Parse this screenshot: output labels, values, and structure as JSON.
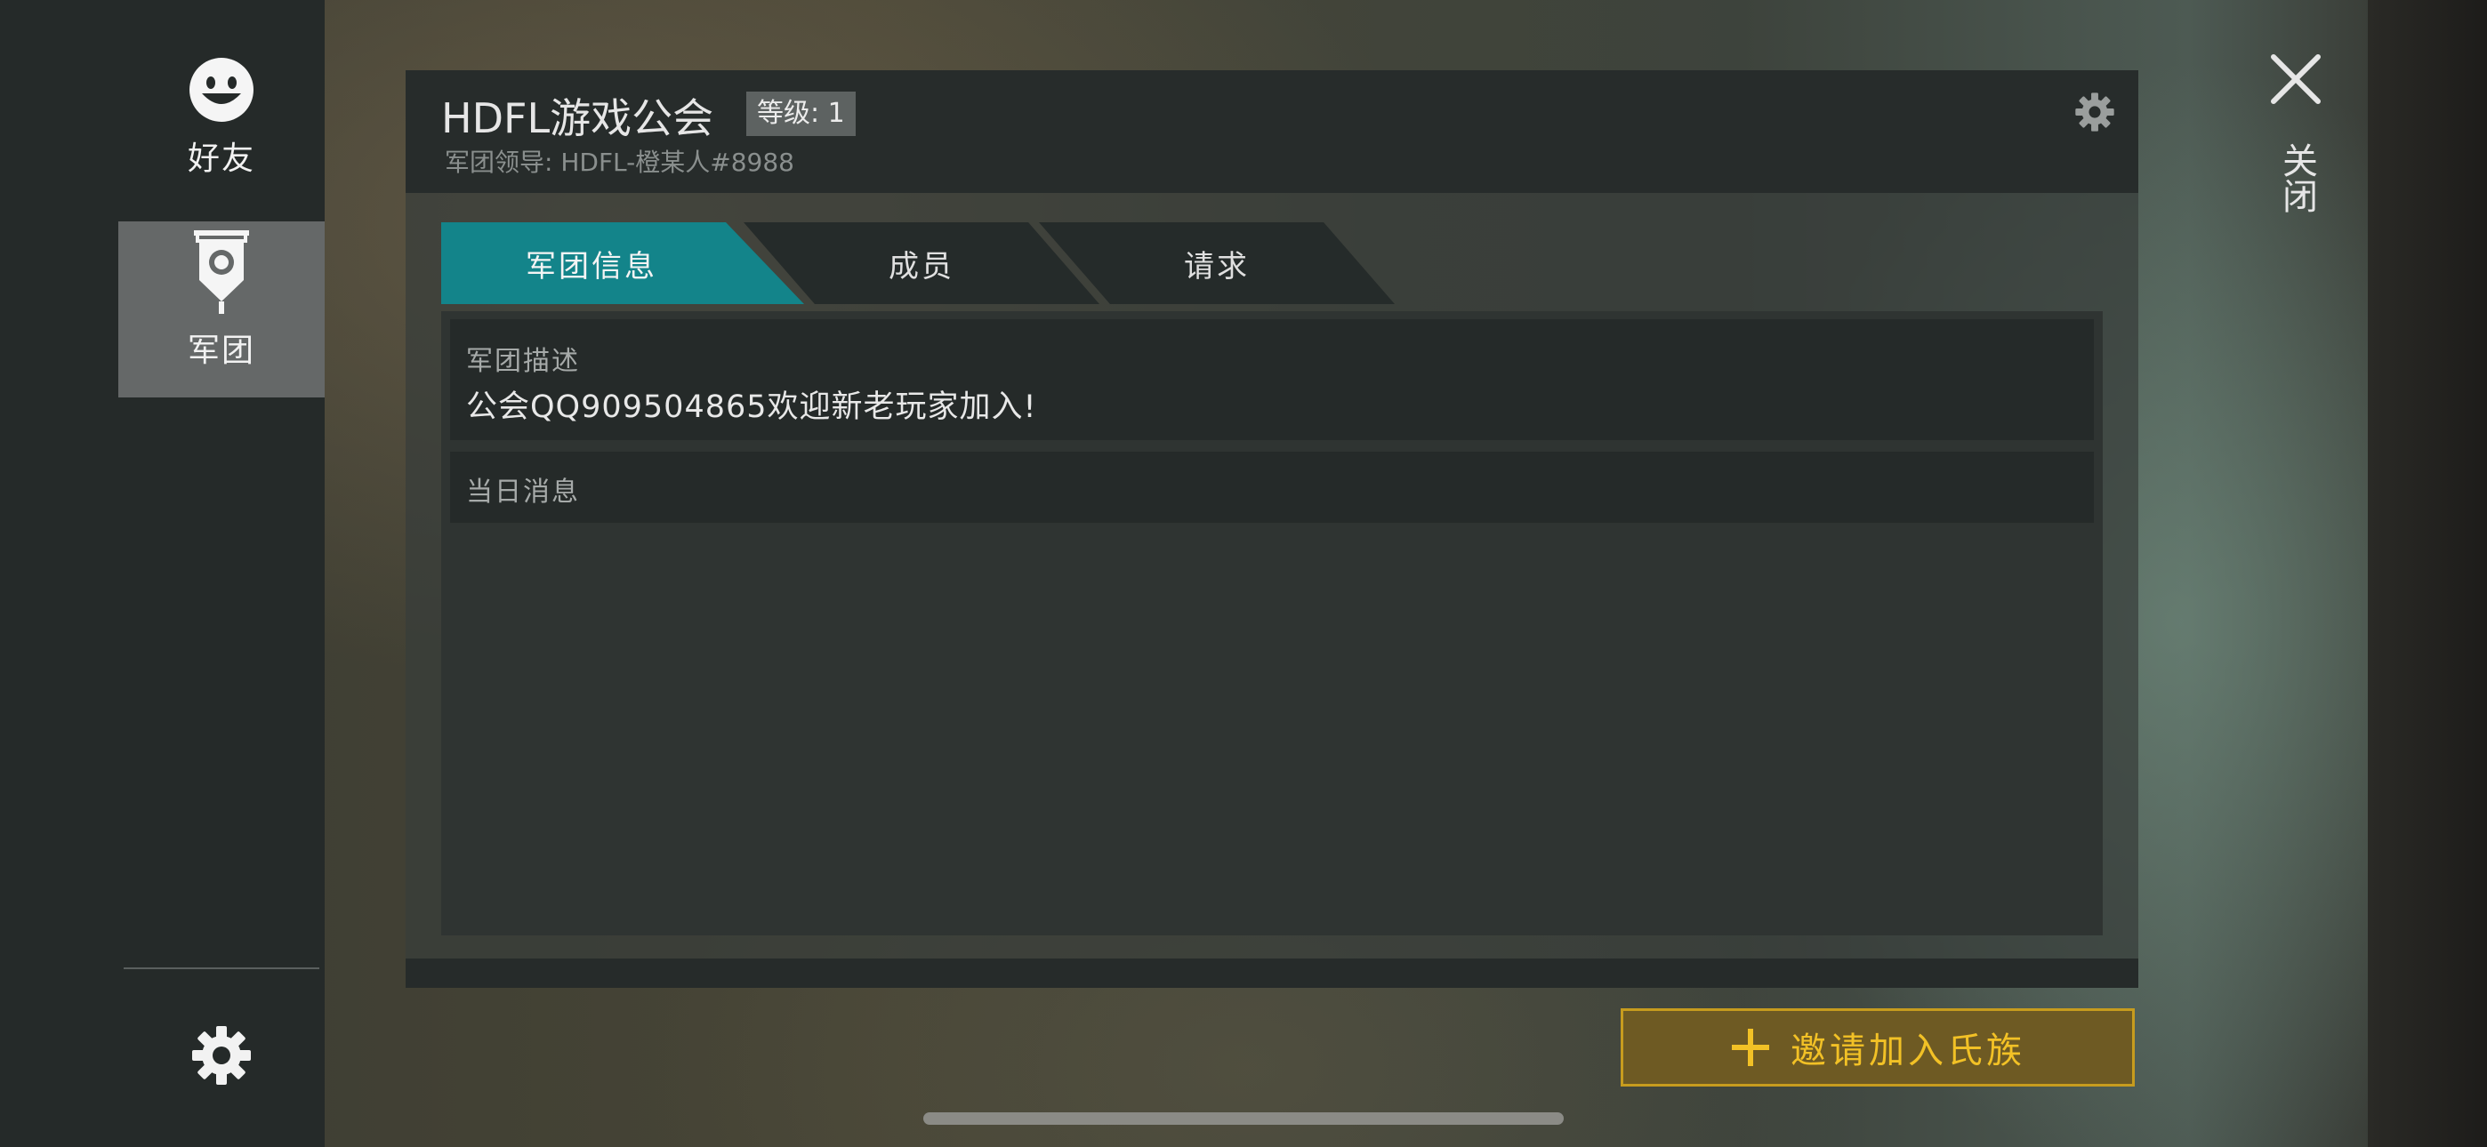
{
  "sidebar": {
    "items": [
      {
        "label": "好友",
        "icon": "smiley-face-icon"
      },
      {
        "label": "军团",
        "icon": "legion-banner-icon"
      }
    ],
    "settings_icon": "gear-icon"
  },
  "guild": {
    "name": "HDFL游戏公会",
    "level_badge": "等级: 1",
    "leader_line": "军团领导: HDFL-橙某人#8988",
    "settings_icon": "gear-icon"
  },
  "tabs": [
    {
      "label": "军团信息",
      "active": true
    },
    {
      "label": "成员",
      "active": false
    },
    {
      "label": "请求",
      "active": false
    }
  ],
  "content": {
    "description_title": "军团描述",
    "description_text": "公会QQ909504865欢迎新老玩家加入!",
    "daily_title": "当日消息"
  },
  "actions": {
    "invite_label": "邀请加入氏族",
    "close_label": "关闭"
  },
  "colors": {
    "active_tab": "#13848a",
    "invite_text": "#f2c126",
    "invite_border": "#c79c1e",
    "invite_bg": "#6e5a23"
  }
}
